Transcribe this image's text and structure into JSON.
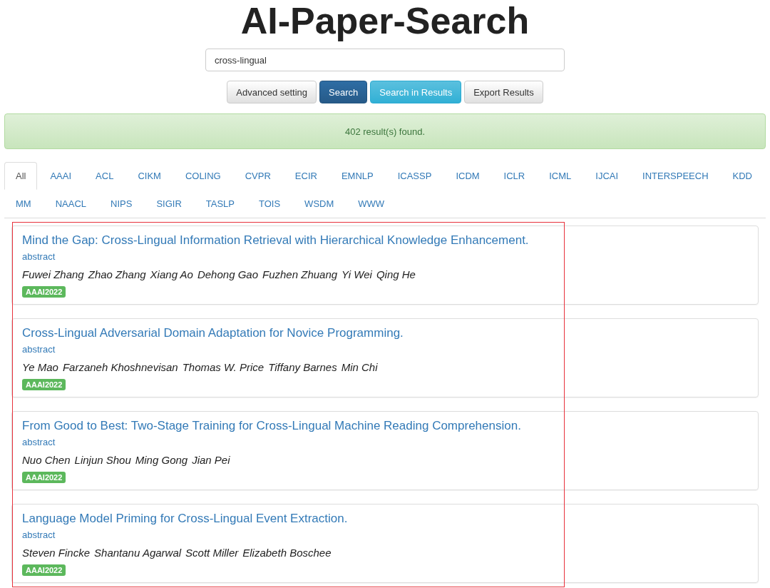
{
  "title": "AI-Paper-Search",
  "search": {
    "value": "cross-lingual"
  },
  "buttons": [
    {
      "label": "Advanced setting",
      "kind": "default"
    },
    {
      "label": "Search",
      "kind": "primary"
    },
    {
      "label": "Search in Results",
      "kind": "info"
    },
    {
      "label": "Export Results",
      "kind": "default"
    }
  ],
  "result_message": "402 result(s) found.",
  "tabs": [
    {
      "label": "All",
      "selected": true
    },
    {
      "label": "AAAI",
      "selected": false
    },
    {
      "label": "ACL",
      "selected": false
    },
    {
      "label": "CIKM",
      "selected": false
    },
    {
      "label": "COLING",
      "selected": false
    },
    {
      "label": "CVPR",
      "selected": false
    },
    {
      "label": "ECIR",
      "selected": false
    },
    {
      "label": "EMNLP",
      "selected": false
    },
    {
      "label": "ICASSP",
      "selected": false
    },
    {
      "label": "ICDM",
      "selected": false
    },
    {
      "label": "ICLR",
      "selected": false
    },
    {
      "label": "ICML",
      "selected": false
    },
    {
      "label": "IJCAI",
      "selected": false
    },
    {
      "label": "INTERSPEECH",
      "selected": false
    },
    {
      "label": "KDD",
      "selected": false
    },
    {
      "label": "MM",
      "selected": false
    },
    {
      "label": "NAACL",
      "selected": false
    },
    {
      "label": "NIPS",
      "selected": false
    },
    {
      "label": "SIGIR",
      "selected": false
    },
    {
      "label": "TASLP",
      "selected": false
    },
    {
      "label": "TOIS",
      "selected": false
    },
    {
      "label": "WSDM",
      "selected": false
    },
    {
      "label": "WWW",
      "selected": false
    }
  ],
  "papers": [
    {
      "title": "Mind the Gap: Cross-Lingual Information Retrieval with Hierarchical Knowledge Enhancement.",
      "abstract_link": "abstract",
      "authors": [
        "Fuwei Zhang",
        "Zhao Zhang",
        "Xiang Ao",
        "Dehong Gao",
        "Fuzhen Zhuang",
        "Yi Wei",
        "Qing He"
      ],
      "venue": "AAAI2022"
    },
    {
      "title": "Cross-Lingual Adversarial Domain Adaptation for Novice Programming.",
      "abstract_link": "abstract",
      "authors": [
        "Ye Mao",
        "Farzaneh Khoshnevisan",
        "Thomas W. Price",
        "Tiffany Barnes",
        "Min Chi"
      ],
      "venue": "AAAI2022"
    },
    {
      "title": "From Good to Best: Two-Stage Training for Cross-Lingual Machine Reading Comprehension.",
      "abstract_link": "abstract",
      "authors": [
        "Nuo Chen",
        "Linjun Shou",
        "Ming Gong",
        "Jian Pei"
      ],
      "venue": "AAAI2022"
    },
    {
      "title": "Language Model Priming for Cross-Lingual Event Extraction.",
      "abstract_link": "abstract",
      "authors": [
        "Steven Fincke",
        "Shantanu Agarwal",
        "Scott Miller",
        "Elizabeth Boschee"
      ],
      "venue": "AAAI2022"
    }
  ]
}
